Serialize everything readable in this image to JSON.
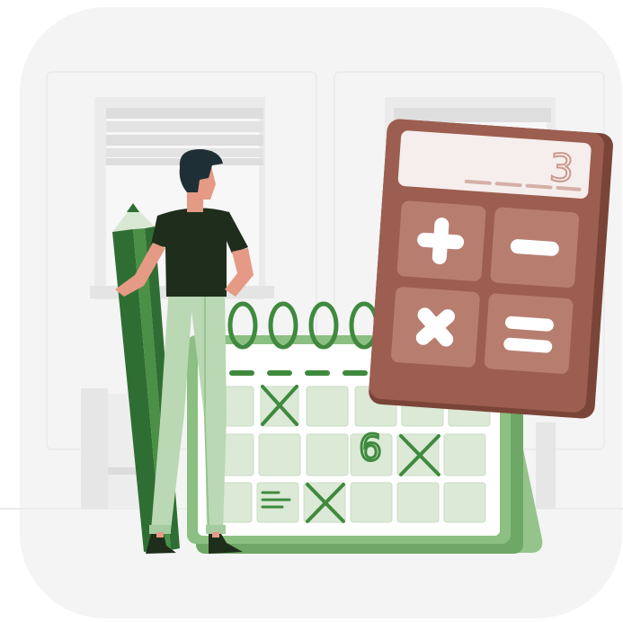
{
  "illustration": {
    "calculator": {
      "display_value": "3",
      "keys": [
        {
          "name": "plus-key",
          "symbol": "+"
        },
        {
          "name": "minus-key",
          "symbol": "−"
        },
        {
          "name": "multiply-key",
          "symbol": "×"
        },
        {
          "name": "equals-key",
          "symbol": "="
        }
      ]
    },
    "calendar": {
      "marked_day_number": "6"
    }
  },
  "colors": {
    "background_card": "#f4f4f4",
    "room_lines": "#e6e6e6",
    "window_gray": "#dcdcdc",
    "calendar_green": "#4f8f4a",
    "calendar_light_green": "#79b06f",
    "calendar_cell": "#dbe9d6",
    "pencil_dark": "#2f6e33",
    "pencil_mid": "#4a9046",
    "pencil_tip": "#d8e8d2",
    "shirt": "#1f2d1c",
    "pants": "#b9d8b3",
    "skin": "#e49a84",
    "hair": "#1f2f36",
    "calculator_body": "#8c5345",
    "calculator_face": "#a76556",
    "calculator_key": "#b77e70",
    "calculator_screen": "#f6eeec",
    "calculator_screen_text": "#c99a90",
    "mark_green": "#3f8a3d"
  }
}
